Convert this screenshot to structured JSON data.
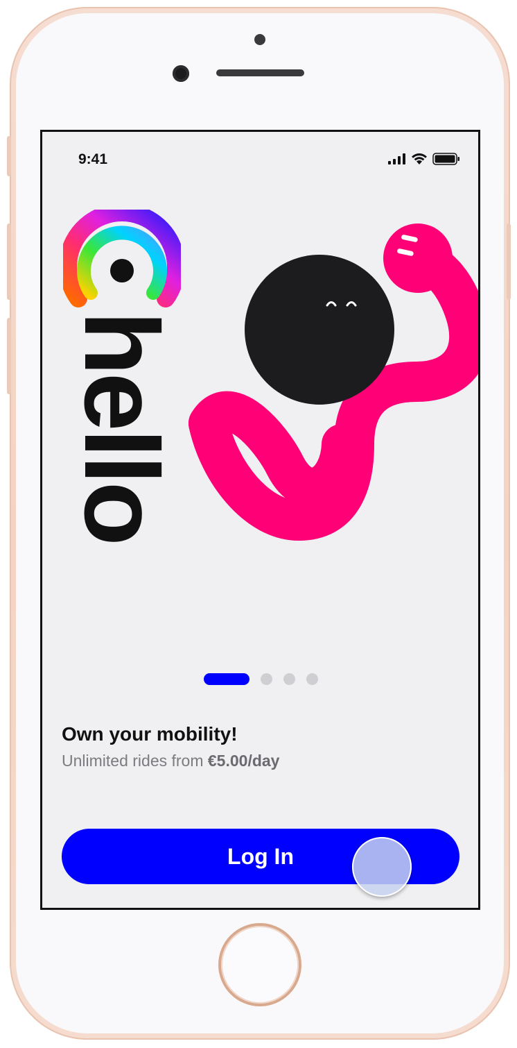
{
  "status_bar": {
    "time": "9:41",
    "icons": [
      "cellular-signal-icon",
      "wifi-icon",
      "battery-icon"
    ]
  },
  "brand": {
    "name": "hello",
    "logo_colors": [
      "#ff2d55",
      "#ff9500",
      "#ffcc00",
      "#34c759",
      "#0000ff",
      "#5ac8fa",
      "#af52de"
    ]
  },
  "carousel": {
    "page_count": 4,
    "active_index": 0
  },
  "onboarding": {
    "headline": "Own your mobility!",
    "subline_prefix": "Unlimited rides from ",
    "subline_price": "€5.00/day"
  },
  "actions": {
    "login_label": "Log In"
  },
  "colors": {
    "accent": "#0000ff",
    "mascot_pink": "#ff0077",
    "mascot_head": "#1c1c1e",
    "background": "#f0eff2"
  }
}
